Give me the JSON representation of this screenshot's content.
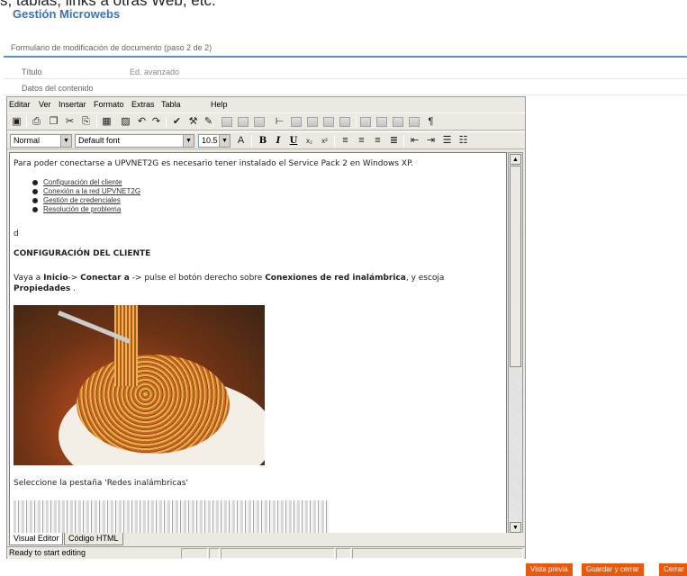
{
  "top_cut_text": "s, tablas, links a otras Web, etc.",
  "app_title": "Gestión Microwebs",
  "form_title": "Formulario de modificación de documento (paso 2 de 2)",
  "fields": [
    {
      "label": "Título",
      "value": "Ed. avanzado"
    },
    {
      "label": "Datos del contenido",
      "value": ""
    }
  ],
  "editor": {
    "menu": [
      "Editar",
      "Ver",
      "Insertar",
      "Formato",
      "Extras",
      "Tabla",
      "Help"
    ],
    "style_select": "Normal",
    "font_select": "Default font",
    "size_select": "10.5",
    "format_buttons": [
      "B",
      "I",
      "U"
    ],
    "content": {
      "intro": "Para poder conectarse a UPVNET2G es necesario tener instalado el Service Pack 2 en Windows XP.",
      "links": [
        "Configuración del cliente",
        "Conexión a la red UPVNET2G",
        "Gestión de credenciales",
        "Resolución de problema"
      ],
      "single_char": "d",
      "heading": "CONFIGURACIÓN DEL CLIENTE",
      "instruction_parts": {
        "p1": "Vaya a ",
        "b1": "Inicio",
        "p2": "-> ",
        "b2": "Conectar a",
        "p3": " -> pulse el botón derecho sobre ",
        "b3": "Conexiones de red inalámbrica",
        "p4": ", y escoja ",
        "b4": "Propiedades",
        "p5": " ."
      },
      "select_tab_text": "Seleccione la pestaña 'Redes inalámbricas'"
    },
    "tabs": [
      "Visual Editor",
      "Código HTML"
    ],
    "status": "Ready to start editing"
  },
  "buttons": {
    "preview": "Vista previa",
    "save_close": "Guardar y cerrar",
    "close": "Cerrar"
  },
  "colors": {
    "accent": "#3a73b8",
    "button": "#e8590c"
  }
}
